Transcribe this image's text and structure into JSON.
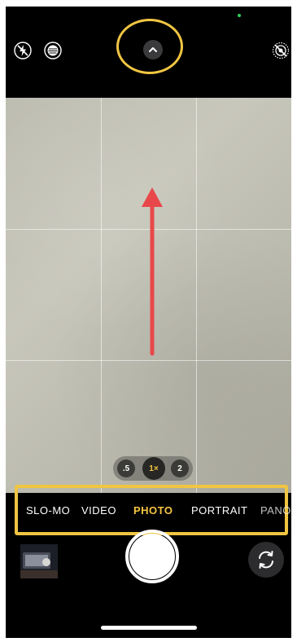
{
  "zoom": {
    "options": [
      ".5",
      "1×",
      "2"
    ],
    "selected": "1×"
  },
  "modes": {
    "items": [
      "SLO-MO",
      "VIDEO",
      "PHOTO",
      "PORTRAIT",
      "PANO"
    ],
    "selected": "PHOTO"
  },
  "colors": {
    "highlight": "#f0c542",
    "arrow": "#e8484a",
    "active_mode": "#f5c542"
  },
  "icons": {
    "top_left_1": "flash-off-icon",
    "top_left_2": "night-mode-icon",
    "top_center": "chevron-up-icon",
    "top_right": "live-photo-off-icon",
    "bottom_right": "camera-flip-icon"
  }
}
